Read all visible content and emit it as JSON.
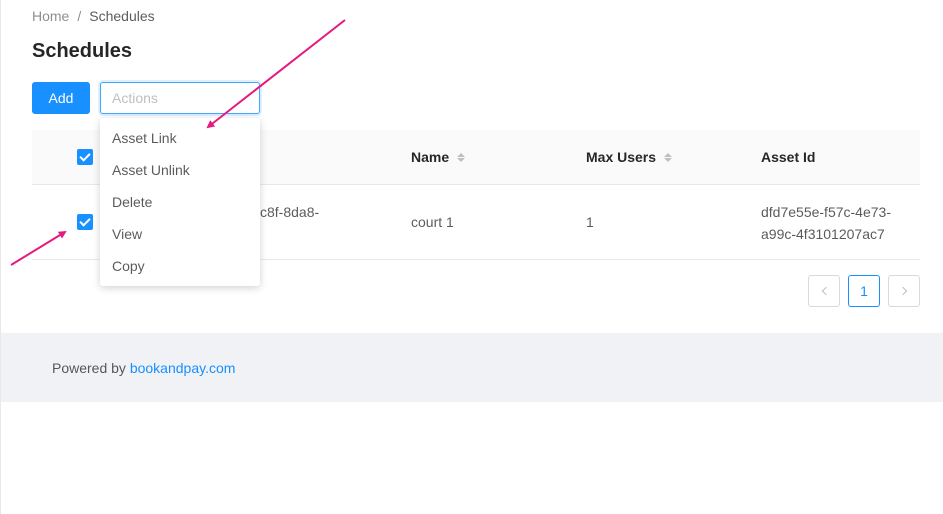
{
  "breadcrumb": {
    "home": "Home",
    "separator": "/",
    "current": "Schedules"
  },
  "page_title": "Schedules",
  "toolbar": {
    "add_label": "Add",
    "actions_placeholder": "Actions"
  },
  "actions_menu": {
    "options": [
      "Asset Link",
      "Asset Unlink",
      "Delete",
      "View",
      "Copy"
    ]
  },
  "table": {
    "columns": [
      "Name",
      "Max Users",
      "Asset Id"
    ],
    "header_checkbox_checked": true,
    "rows": [
      {
        "checked": true,
        "id_partial": "c8f-8da8-",
        "name": "court 1",
        "max_users": "1",
        "asset_id_line1": "dfd7e55e-f57c-4e73-",
        "asset_id_line2": "a99c-4f3101207ac7"
      }
    ]
  },
  "pagination": {
    "current_page": "1"
  },
  "footer": {
    "powered_by": "Powered by",
    "link": "bookandpay.com"
  },
  "colors": {
    "primary": "#1890ff",
    "annotation_arrow": "#e6197e",
    "footer_bg": "#f0f2f5"
  }
}
